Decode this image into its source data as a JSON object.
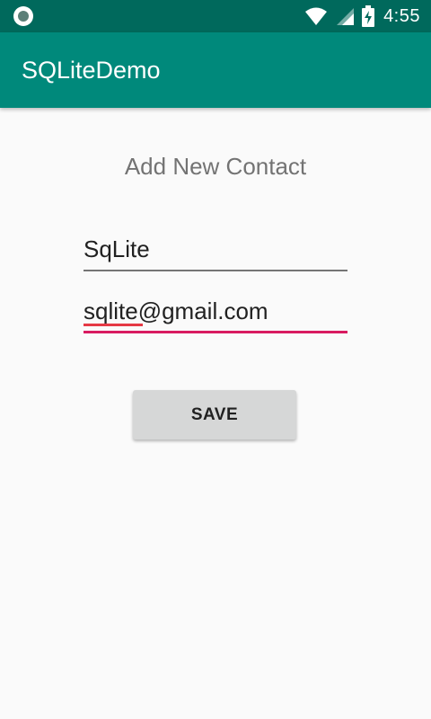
{
  "status_bar": {
    "time": "4:55",
    "icons": [
      "notification-dot-icon",
      "wifi-icon",
      "signal-icon",
      "battery-charging-icon"
    ]
  },
  "app_bar": {
    "title": "SQLiteDemo"
  },
  "form": {
    "title": "Add New Contact",
    "name_value": "SqLite",
    "email_value": "sqlite@gmail.com",
    "save_label": "SAVE"
  },
  "colors": {
    "status_bar": "#00695c",
    "app_bar": "#00897b",
    "accent": "#d81b60",
    "button": "#d6d7d7"
  }
}
